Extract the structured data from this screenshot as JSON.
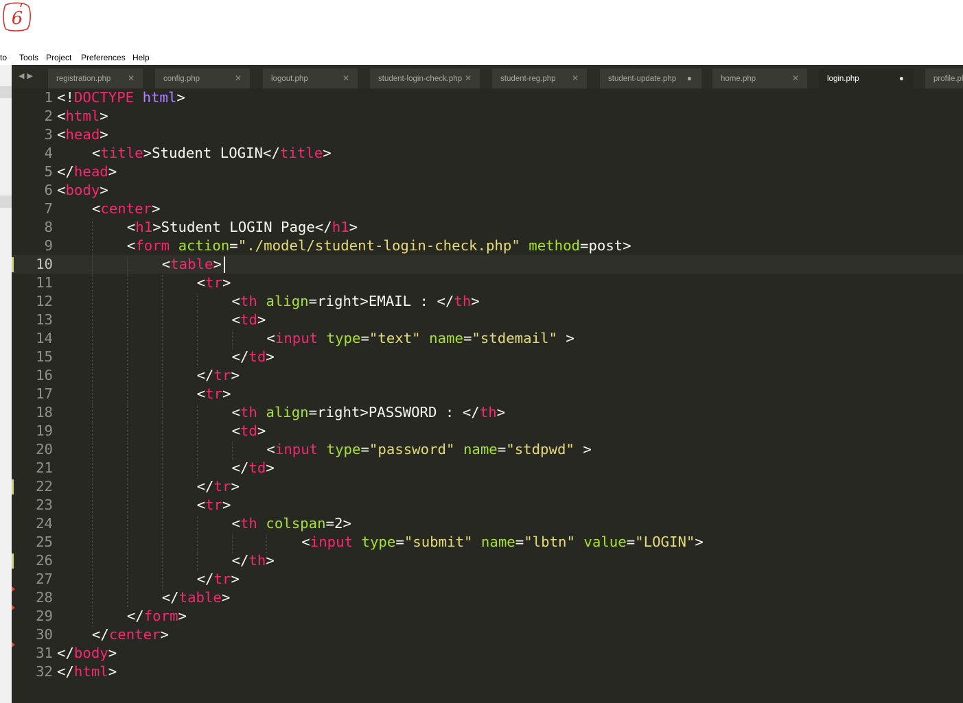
{
  "annotation": {
    "label": "6"
  },
  "menubar": {
    "items": [
      "to",
      "Tools",
      "Project",
      "Preferences",
      "Help"
    ]
  },
  "tabs": [
    {
      "label": "registration.php",
      "state": "close"
    },
    {
      "label": "config.php",
      "state": "close"
    },
    {
      "label": "logout.php",
      "state": "close"
    },
    {
      "label": "student-login-check.php",
      "state": "close"
    },
    {
      "label": "student-reg.php",
      "state": "close"
    },
    {
      "label": "student-update.php",
      "state": "dirty"
    },
    {
      "label": "home.php",
      "state": "close"
    },
    {
      "label": "login.php",
      "state": "dirty",
      "active": true
    },
    {
      "label": "profile.php",
      "state": "none"
    }
  ],
  "editor": {
    "current_line": 10,
    "modified_lines": [
      10,
      22,
      26
    ],
    "fold_arrow_lines": [
      28,
      29,
      31
    ],
    "lines": [
      {
        "n": "1",
        "indent": 0,
        "tokens": [
          [
            "p",
            "<!"
          ],
          [
            "t",
            "DOCTYPE"
          ],
          [
            "p",
            " "
          ],
          [
            "k",
            "html"
          ],
          [
            "p",
            ">"
          ]
        ]
      },
      {
        "n": "2",
        "indent": 0,
        "tokens": [
          [
            "p",
            "<"
          ],
          [
            "t",
            "html"
          ],
          [
            "p",
            ">"
          ]
        ]
      },
      {
        "n": "3",
        "indent": 0,
        "tokens": [
          [
            "p",
            "<"
          ],
          [
            "t",
            "head"
          ],
          [
            "p",
            ">"
          ]
        ]
      },
      {
        "n": "4",
        "indent": 1,
        "tokens": [
          [
            "p",
            "<"
          ],
          [
            "t",
            "title"
          ],
          [
            "p",
            ">Student LOGIN</"
          ],
          [
            "t",
            "title"
          ],
          [
            "p",
            ">"
          ]
        ]
      },
      {
        "n": "5",
        "indent": 0,
        "tokens": [
          [
            "p",
            "</"
          ],
          [
            "t",
            "head"
          ],
          [
            "p",
            ">"
          ]
        ]
      },
      {
        "n": "6",
        "indent": 0,
        "tokens": [
          [
            "p",
            "<"
          ],
          [
            "t",
            "body"
          ],
          [
            "p",
            ">"
          ]
        ]
      },
      {
        "n": "7",
        "indent": 1,
        "tokens": [
          [
            "p",
            "<"
          ],
          [
            "t",
            "center"
          ],
          [
            "p",
            ">"
          ]
        ]
      },
      {
        "n": "8",
        "indent": 2,
        "tokens": [
          [
            "p",
            "<"
          ],
          [
            "t",
            "h1"
          ],
          [
            "p",
            ">Student LOGIN Page</"
          ],
          [
            "t",
            "h1"
          ],
          [
            "p",
            ">"
          ]
        ]
      },
      {
        "n": "9",
        "indent": 2,
        "tokens": [
          [
            "p",
            "<"
          ],
          [
            "t",
            "form"
          ],
          [
            "p",
            " "
          ],
          [
            "a",
            "action"
          ],
          [
            "p",
            "="
          ],
          [
            "s",
            "\"./model/student-login-check.php\""
          ],
          [
            "p",
            " "
          ],
          [
            "a",
            "method"
          ],
          [
            "p",
            "=post>"
          ]
        ]
      },
      {
        "n": "10",
        "indent": 3,
        "tokens": [
          [
            "p",
            "<"
          ],
          [
            "t",
            "table"
          ],
          [
            "p",
            ">"
          ]
        ]
      },
      {
        "n": "11",
        "indent": 4,
        "tokens": [
          [
            "p",
            "<"
          ],
          [
            "t",
            "tr"
          ],
          [
            "p",
            ">"
          ]
        ]
      },
      {
        "n": "12",
        "indent": 5,
        "tokens": [
          [
            "p",
            "<"
          ],
          [
            "t",
            "th"
          ],
          [
            "p",
            " "
          ],
          [
            "a",
            "align"
          ],
          [
            "p",
            "=right>EMAIL : </"
          ],
          [
            "t",
            "th"
          ],
          [
            "p",
            ">"
          ]
        ]
      },
      {
        "n": "13",
        "indent": 5,
        "tokens": [
          [
            "p",
            "<"
          ],
          [
            "t",
            "td"
          ],
          [
            "p",
            ">"
          ]
        ]
      },
      {
        "n": "14",
        "indent": 6,
        "tokens": [
          [
            "p",
            "<"
          ],
          [
            "t",
            "input"
          ],
          [
            "p",
            " "
          ],
          [
            "a",
            "type"
          ],
          [
            "p",
            "="
          ],
          [
            "s",
            "\"text\""
          ],
          [
            "p",
            " "
          ],
          [
            "a",
            "name"
          ],
          [
            "p",
            "="
          ],
          [
            "s",
            "\"stdemail\""
          ],
          [
            "p",
            " >"
          ]
        ]
      },
      {
        "n": "15",
        "indent": 5,
        "tokens": [
          [
            "p",
            "</"
          ],
          [
            "t",
            "td"
          ],
          [
            "p",
            ">"
          ]
        ]
      },
      {
        "n": "16",
        "indent": 4,
        "tokens": [
          [
            "p",
            "</"
          ],
          [
            "t",
            "tr"
          ],
          [
            "p",
            ">"
          ]
        ]
      },
      {
        "n": "17",
        "indent": 4,
        "tokens": [
          [
            "p",
            "<"
          ],
          [
            "t",
            "tr"
          ],
          [
            "p",
            ">"
          ]
        ]
      },
      {
        "n": "18",
        "indent": 5,
        "tokens": [
          [
            "p",
            "<"
          ],
          [
            "t",
            "th"
          ],
          [
            "p",
            " "
          ],
          [
            "a",
            "align"
          ],
          [
            "p",
            "=right>PASSWORD : </"
          ],
          [
            "t",
            "th"
          ],
          [
            "p",
            ">"
          ]
        ]
      },
      {
        "n": "19",
        "indent": 5,
        "tokens": [
          [
            "p",
            "<"
          ],
          [
            "t",
            "td"
          ],
          [
            "p",
            ">"
          ]
        ]
      },
      {
        "n": "20",
        "indent": 6,
        "tokens": [
          [
            "p",
            "<"
          ],
          [
            "t",
            "input"
          ],
          [
            "p",
            " "
          ],
          [
            "a",
            "type"
          ],
          [
            "p",
            "="
          ],
          [
            "s",
            "\"password\""
          ],
          [
            "p",
            " "
          ],
          [
            "a",
            "name"
          ],
          [
            "p",
            "="
          ],
          [
            "s",
            "\"stdpwd\""
          ],
          [
            "p",
            " >"
          ]
        ]
      },
      {
        "n": "21",
        "indent": 5,
        "tokens": [
          [
            "p",
            "</"
          ],
          [
            "t",
            "td"
          ],
          [
            "p",
            ">"
          ]
        ]
      },
      {
        "n": "22",
        "indent": 4,
        "tokens": [
          [
            "p",
            "</"
          ],
          [
            "t",
            "tr"
          ],
          [
            "p",
            ">"
          ]
        ]
      },
      {
        "n": "23",
        "indent": 4,
        "tokens": [
          [
            "p",
            "<"
          ],
          [
            "t",
            "tr"
          ],
          [
            "p",
            ">"
          ]
        ]
      },
      {
        "n": "24",
        "indent": 5,
        "tokens": [
          [
            "p",
            "<"
          ],
          [
            "t",
            "th"
          ],
          [
            "p",
            " "
          ],
          [
            "a",
            "colspan"
          ],
          [
            "p",
            "=2>"
          ]
        ]
      },
      {
        "n": "25",
        "indent": 7,
        "tokens": [
          [
            "p",
            "<"
          ],
          [
            "t",
            "input"
          ],
          [
            "p",
            " "
          ],
          [
            "a",
            "type"
          ],
          [
            "p",
            "="
          ],
          [
            "s",
            "\"submit\""
          ],
          [
            "p",
            " "
          ],
          [
            "a",
            "name"
          ],
          [
            "p",
            "="
          ],
          [
            "s",
            "\"lbtn\""
          ],
          [
            "p",
            " "
          ],
          [
            "a",
            "value"
          ],
          [
            "p",
            "="
          ],
          [
            "s",
            "\"LOGIN\""
          ],
          [
            "p",
            ">"
          ]
        ]
      },
      {
        "n": "26",
        "indent": 5,
        "tokens": [
          [
            "p",
            "</"
          ],
          [
            "t",
            "th"
          ],
          [
            "p",
            ">"
          ]
        ]
      },
      {
        "n": "27",
        "indent": 4,
        "tokens": [
          [
            "p",
            "</"
          ],
          [
            "t",
            "tr"
          ],
          [
            "p",
            ">"
          ]
        ]
      },
      {
        "n": "28",
        "indent": 3,
        "tokens": [
          [
            "p",
            "</"
          ],
          [
            "t",
            "table"
          ],
          [
            "p",
            ">"
          ]
        ]
      },
      {
        "n": "29",
        "indent": 2,
        "tokens": [
          [
            "p",
            "</"
          ],
          [
            "t",
            "form"
          ],
          [
            "p",
            ">"
          ]
        ]
      },
      {
        "n": "30",
        "indent": 1,
        "tokens": [
          [
            "p",
            "</"
          ],
          [
            "t",
            "center"
          ],
          [
            "p",
            ">"
          ]
        ]
      },
      {
        "n": "31",
        "indent": 0,
        "tokens": [
          [
            "p",
            "</"
          ],
          [
            "t",
            "body"
          ],
          [
            "p",
            ">"
          ]
        ]
      },
      {
        "n": "32",
        "indent": 0,
        "tokens": [
          [
            "p",
            "</"
          ],
          [
            "t",
            "html"
          ],
          [
            "p",
            ">"
          ]
        ]
      }
    ]
  }
}
